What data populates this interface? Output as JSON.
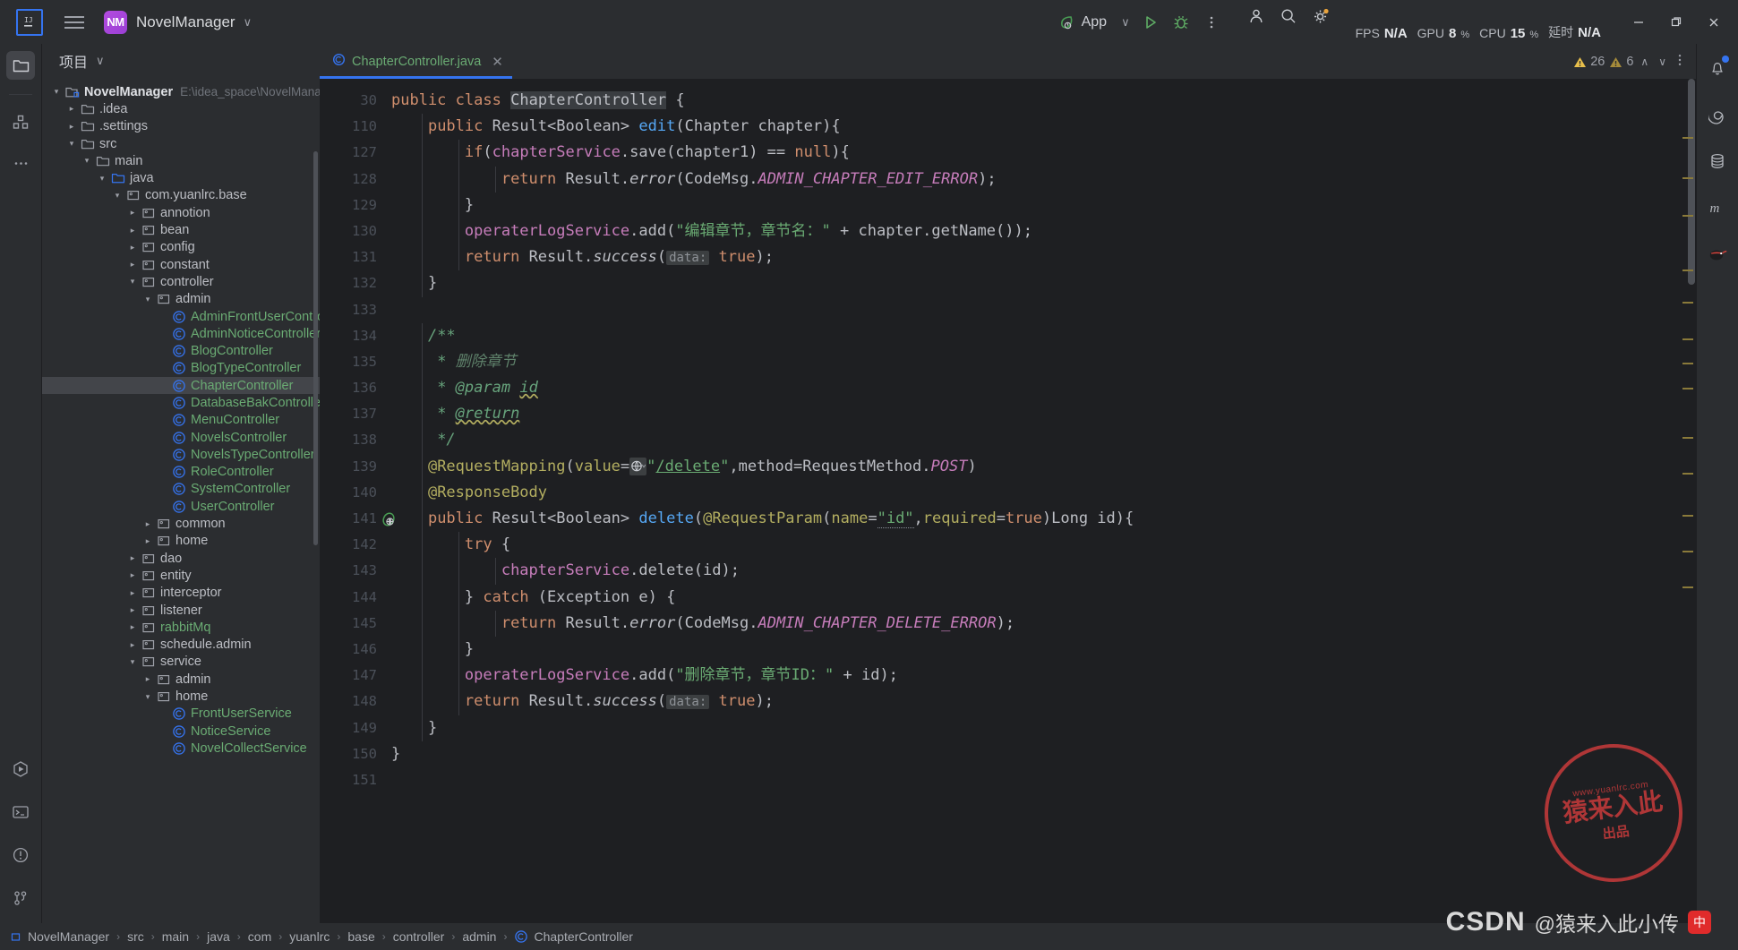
{
  "titlebar": {
    "menu_icon": "hamburger-icon",
    "project_badge": "NM",
    "project_name": "NovelManager",
    "chevron": "∨",
    "run_config": "App",
    "run_icon": "run-icon",
    "debug_icon": "debug-icon",
    "more_icon": "more-vertical-icon",
    "metrics": [
      {
        "key": "FPS",
        "value": "N/A",
        "unit": ""
      },
      {
        "key": "GPU",
        "value": "8",
        "unit": "%"
      },
      {
        "key": "CPU",
        "value": "15",
        "unit": "%"
      },
      {
        "key": "延时",
        "value": "N/A",
        "unit": ""
      }
    ],
    "account_icon": "user-account-icon",
    "search_icon": "search-icon",
    "settings_icon": "gear-icon",
    "minimize": "—",
    "maximize": "❐",
    "close": "✕"
  },
  "left_rail": {
    "top": [
      {
        "name": "project-tool-icon",
        "active": true
      },
      {
        "name": "structure-tool-icon",
        "active": false
      },
      {
        "name": "more-tools-icon",
        "active": false
      }
    ],
    "bottom": [
      {
        "name": "run-tool-icon"
      },
      {
        "name": "terminal-tool-icon"
      },
      {
        "name": "problems-tool-icon"
      },
      {
        "name": "version-control-icon"
      }
    ]
  },
  "right_rail": [
    {
      "name": "notifications-bell-icon",
      "badge": true
    },
    {
      "name": "spiral-icon",
      "badge": false
    },
    {
      "name": "database-icon",
      "badge": false
    },
    {
      "name": "maven-m-icon",
      "badge": false
    },
    {
      "name": "ninja-plugin-icon",
      "badge": false
    }
  ],
  "project_panel": {
    "title": "项目",
    "title_chevron": "∨",
    "tree": [
      {
        "depth": 0,
        "arrow": "down",
        "icon": "module-icon",
        "label": "NovelManager",
        "style": "root",
        "path": "E:\\idea_space\\NovelManager"
      },
      {
        "depth": 1,
        "arrow": "right",
        "icon": "folder-icon",
        "label": ".idea",
        "style": "plain"
      },
      {
        "depth": 1,
        "arrow": "right",
        "icon": "folder-icon",
        "label": ".settings",
        "style": "plain"
      },
      {
        "depth": 1,
        "arrow": "down",
        "icon": "folder-icon",
        "label": "src",
        "style": "plain"
      },
      {
        "depth": 2,
        "arrow": "down",
        "icon": "folder-icon",
        "label": "main",
        "style": "plain"
      },
      {
        "depth": 3,
        "arrow": "down",
        "icon": "source-folder-icon",
        "label": "java",
        "style": "plain"
      },
      {
        "depth": 4,
        "arrow": "down",
        "icon": "package-icon",
        "label": "com.yuanlrc.base",
        "style": "plain"
      },
      {
        "depth": 5,
        "arrow": "right",
        "icon": "package-icon",
        "label": "annotion",
        "style": "plain"
      },
      {
        "depth": 5,
        "arrow": "right",
        "icon": "package-icon",
        "label": "bean",
        "style": "plain"
      },
      {
        "depth": 5,
        "arrow": "right",
        "icon": "package-icon",
        "label": "config",
        "style": "plain"
      },
      {
        "depth": 5,
        "arrow": "right",
        "icon": "package-icon",
        "label": "constant",
        "style": "plain"
      },
      {
        "depth": 5,
        "arrow": "down",
        "icon": "package-icon",
        "label": "controller",
        "style": "plain"
      },
      {
        "depth": 6,
        "arrow": "down",
        "icon": "package-icon",
        "label": "admin",
        "style": "plain"
      },
      {
        "depth": 7,
        "arrow": "none",
        "icon": "class-icon",
        "label": "AdminFrontUserController",
        "style": "green"
      },
      {
        "depth": 7,
        "arrow": "none",
        "icon": "class-icon",
        "label": "AdminNoticeController",
        "style": "green"
      },
      {
        "depth": 7,
        "arrow": "none",
        "icon": "class-icon",
        "label": "BlogController",
        "style": "green"
      },
      {
        "depth": 7,
        "arrow": "none",
        "icon": "class-icon",
        "label": "BlogTypeController",
        "style": "green"
      },
      {
        "depth": 7,
        "arrow": "none",
        "icon": "class-icon",
        "label": "ChapterController",
        "style": "green",
        "selected": true
      },
      {
        "depth": 7,
        "arrow": "none",
        "icon": "class-icon",
        "label": "DatabaseBakController",
        "style": "green"
      },
      {
        "depth": 7,
        "arrow": "none",
        "icon": "class-icon",
        "label": "MenuController",
        "style": "green"
      },
      {
        "depth": 7,
        "arrow": "none",
        "icon": "class-icon",
        "label": "NovelsController",
        "style": "green"
      },
      {
        "depth": 7,
        "arrow": "none",
        "icon": "class-icon",
        "label": "NovelsTypeController",
        "style": "green"
      },
      {
        "depth": 7,
        "arrow": "none",
        "icon": "class-icon",
        "label": "RoleController",
        "style": "green"
      },
      {
        "depth": 7,
        "arrow": "none",
        "icon": "class-icon",
        "label": "SystemController",
        "style": "green"
      },
      {
        "depth": 7,
        "arrow": "none",
        "icon": "class-icon",
        "label": "UserController",
        "style": "green"
      },
      {
        "depth": 6,
        "arrow": "right",
        "icon": "package-icon",
        "label": "common",
        "style": "plain"
      },
      {
        "depth": 6,
        "arrow": "right",
        "icon": "package-icon",
        "label": "home",
        "style": "plain"
      },
      {
        "depth": 5,
        "arrow": "right",
        "icon": "package-icon",
        "label": "dao",
        "style": "plain"
      },
      {
        "depth": 5,
        "arrow": "right",
        "icon": "package-icon",
        "label": "entity",
        "style": "plain"
      },
      {
        "depth": 5,
        "arrow": "right",
        "icon": "package-icon",
        "label": "interceptor",
        "style": "plain"
      },
      {
        "depth": 5,
        "arrow": "right",
        "icon": "package-icon",
        "label": "listener",
        "style": "plain"
      },
      {
        "depth": 5,
        "arrow": "right",
        "icon": "package-icon",
        "label": "rabbitMq",
        "style": "green"
      },
      {
        "depth": 5,
        "arrow": "right",
        "icon": "package-icon",
        "label": "schedule.admin",
        "style": "plain"
      },
      {
        "depth": 5,
        "arrow": "down",
        "icon": "package-icon",
        "label": "service",
        "style": "plain"
      },
      {
        "depth": 6,
        "arrow": "right",
        "icon": "package-icon",
        "label": "admin",
        "style": "plain"
      },
      {
        "depth": 6,
        "arrow": "down",
        "icon": "package-icon",
        "label": "home",
        "style": "plain"
      },
      {
        "depth": 7,
        "arrow": "none",
        "icon": "class-icon",
        "label": "FrontUserService",
        "style": "green"
      },
      {
        "depth": 7,
        "arrow": "none",
        "icon": "class-icon",
        "label": "NoticeService",
        "style": "green"
      },
      {
        "depth": 7,
        "arrow": "none",
        "icon": "class-icon",
        "label": "NovelCollectService",
        "style": "green"
      }
    ]
  },
  "editor": {
    "tab": {
      "label": "ChapterController.java",
      "icon": "java-class-icon",
      "close": "✕"
    },
    "inspections": {
      "warnings": "26",
      "weak_warnings": "6",
      "up": "∧",
      "down": "∨"
    },
    "lines": [
      {
        "num": "30",
        "indent": 0,
        "html": "<span class=\"kw\">public</span> <span class=\"kw\">class</span> <span class=\"ident-hl txt\">ChapterController</span> <span class=\"txt\">{</span>"
      },
      {
        "num": "110",
        "indent": 1,
        "html": "    <span class=\"kw\">public</span> <span class=\"txt\">Result&lt;Boolean&gt;</span> <span class=\"mth\">edit</span><span class=\"txt\">(Chapter chapter){</span>"
      },
      {
        "num": "127",
        "indent": 2,
        "html": "        <span class=\"kw\">if</span><span class=\"txt\">(</span><span class=\"fld\">chapterService</span><span class=\"txt\">.save(chapter1) == </span><span class=\"kw\">null</span><span class=\"txt\">){</span>"
      },
      {
        "num": "128",
        "indent": 3,
        "html": "            <span class=\"kw\">return</span> <span class=\"txt\">Result.</span><span class=\"mthi\">error</span><span class=\"txt\">(CodeMsg.</span><span class=\"cst\">ADMIN_CHAPTER_EDIT_ERROR</span><span class=\"txt\">);</span>"
      },
      {
        "num": "129",
        "indent": 2,
        "html": "        <span class=\"txt\">}</span>"
      },
      {
        "num": "130",
        "indent": 2,
        "html": "        <span class=\"fld\">operaterLogService</span><span class=\"txt\">.add(</span><span class=\"str\">\"编辑章节，章节名：\"</span><span class=\"txt\"> + chapter.getName());</span>"
      },
      {
        "num": "131",
        "indent": 2,
        "html": "        <span class=\"kw\">return</span> <span class=\"txt\">Result.</span><span class=\"mthi\">success</span><span class=\"txt\">(</span><span class=\"hint\">data:</span> <span class=\"kw\">true</span><span class=\"txt\">);</span>"
      },
      {
        "num": "132",
        "indent": 1,
        "html": "    <span class=\"txt\">}</span>"
      },
      {
        "num": "133",
        "indent": 0,
        "html": ""
      },
      {
        "num": "134",
        "indent": 1,
        "html": "    <span class=\"cmtb\">/**</span>"
      },
      {
        "num": "135",
        "indent": 1,
        "html": "     <span class=\"cmtb\">* </span><span class=\"cmt\">删除章节</span>"
      },
      {
        "num": "136",
        "indent": 1,
        "html": "     <span class=\"cmtb\">* </span><span class=\"cmtb\">@param</span> <span class=\"cmtb wavy\">id</span>"
      },
      {
        "num": "137",
        "indent": 1,
        "html": "     <span class=\"cmtb\">* </span><span class=\"cmtb wavy\">@return</span>"
      },
      {
        "num": "138",
        "indent": 1,
        "html": "     <span class=\"cmtb\">*/</span>"
      },
      {
        "num": "139",
        "indent": 1,
        "html": "    <span class=\"ann\">@RequestMapping</span><span class=\"txt\">(</span><span class=\"ann\">value</span><span class=\"txt\">=</span><span class=\"gicon\">⊕∨</span><span class=\"str\">\"</span><span class=\"link\">/delete</span><span class=\"str\">\"</span><span class=\"txt\">,</span><span class=\"txt\">method=RequestMethod.</span><span class=\"cst\">POST</span><span class=\"txt\">)</span>"
      },
      {
        "num": "140",
        "indent": 1,
        "html": "    <span class=\"ann\">@ResponseBody</span>"
      },
      {
        "num": "141",
        "indent": 1,
        "gutter_icon": "web-endpoint-icon",
        "html": "    <span class=\"kw\">public</span> <span class=\"txt\">Result&lt;Boolean&gt;</span> <span class=\"mth\">delete</span><span class=\"txt\">(</span><span class=\"ann\">@RequestParam</span><span class=\"txt\">(</span><span class=\"ann\">name</span><span class=\"txt\">=</span><span class=\"str udot\">\"id\"</span><span class=\"txt\">,</span><span class=\"ann\">required</span><span class=\"txt\">=</span><span class=\"kw\">true</span><span class=\"txt\">)Long id){</span>"
      },
      {
        "num": "142",
        "indent": 2,
        "html": "        <span class=\"kw\">try</span> <span class=\"txt\">{</span>"
      },
      {
        "num": "143",
        "indent": 3,
        "html": "            <span class=\"fld\">chapterService</span><span class=\"txt\">.delete(id);</span>"
      },
      {
        "num": "144",
        "indent": 2,
        "html": "        <span class=\"txt\">} </span><span class=\"kw\">catch</span><span class=\"txt\"> (Exception e) {</span>"
      },
      {
        "num": "145",
        "indent": 3,
        "html": "            <span class=\"kw\">return</span> <span class=\"txt\">Result.</span><span class=\"mthi\">error</span><span class=\"txt\">(CodeMsg.</span><span class=\"cst\">ADMIN_CHAPTER_DELETE_ERROR</span><span class=\"txt\">);</span>"
      },
      {
        "num": "146",
        "indent": 2,
        "html": "        <span class=\"txt\">}</span>"
      },
      {
        "num": "147",
        "indent": 2,
        "html": "        <span class=\"fld\">operaterLogService</span><span class=\"txt\">.add(</span><span class=\"str\">\"删除章节，章节ID：\"</span><span class=\"txt\"> + id);</span>"
      },
      {
        "num": "148",
        "indent": 2,
        "html": "        <span class=\"kw\">return</span> <span class=\"txt\">Result.</span><span class=\"mthi\">success</span><span class=\"txt\">(</span><span class=\"hint\">data:</span> <span class=\"kw\">true</span><span class=\"txt\">);</span>"
      },
      {
        "num": "149",
        "indent": 1,
        "html": "    <span class=\"txt\">}</span>"
      },
      {
        "num": "150",
        "indent": 0,
        "html": "<span class=\"txt\">}</span>"
      },
      {
        "num": "151",
        "indent": 0,
        "html": ""
      }
    ]
  },
  "breadcrumb": [
    {
      "label": "NovelManager",
      "icon": "module-icon"
    },
    {
      "label": "src",
      "icon": ""
    },
    {
      "label": "main",
      "icon": ""
    },
    {
      "label": "java",
      "icon": ""
    },
    {
      "label": "com",
      "icon": ""
    },
    {
      "label": "yuanlrc",
      "icon": ""
    },
    {
      "label": "base",
      "icon": ""
    },
    {
      "label": "controller",
      "icon": ""
    },
    {
      "label": "admin",
      "icon": ""
    },
    {
      "label": "ChapterController",
      "icon": "class-icon"
    }
  ],
  "watermark": {
    "stamp_top": "www.yuanlrc.com",
    "stamp_main": "猿来入此",
    "stamp_sub": "出品",
    "csdn_brand": "CSDN",
    "csdn_user": "@猿来入此小传",
    "csdn_badge": "中"
  },
  "colors": {
    "accent": "#3574f0",
    "bg": "#2b2d30",
    "editor_bg": "#1e1f22",
    "green": "#6aab73",
    "annotation": "#b3ae60",
    "keyword": "#cf8e6d",
    "field": "#c77dbb",
    "method": "#56a8f5"
  }
}
